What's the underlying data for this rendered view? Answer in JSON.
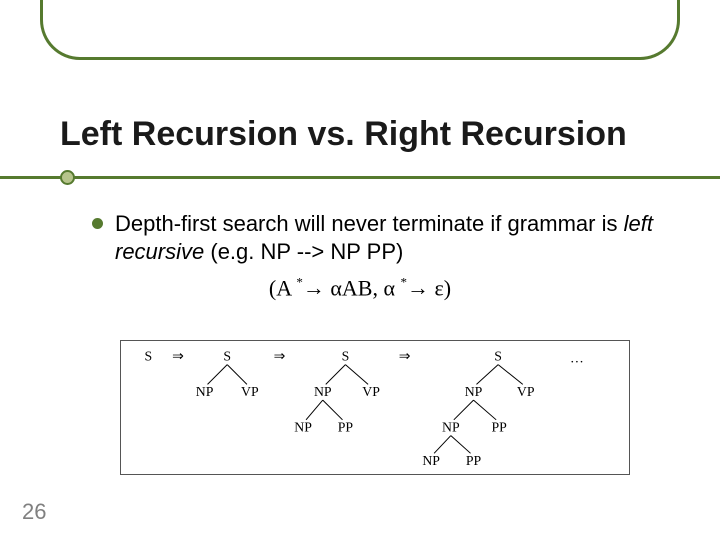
{
  "accent_color": "#567a2f",
  "title": "Left Recursion vs. Right Recursion",
  "bullet_text_a": "Depth-first search will never terminate if grammar is ",
  "bullet_text_italic": "left recursive",
  "bullet_text_b": " (e.g. NP --> NP PP)",
  "formula": {
    "lparen": "(A",
    "arrow1": "→",
    "mid": "αAB, α",
    "arrow2": "→",
    "rhs": "ε)",
    "star": "*"
  },
  "trees": {
    "arrow": "⇒",
    "ellipsis": "…",
    "labels": {
      "S": "S",
      "NP": "NP",
      "VP": "VP",
      "PP": "PP"
    }
  },
  "page_number": "26"
}
